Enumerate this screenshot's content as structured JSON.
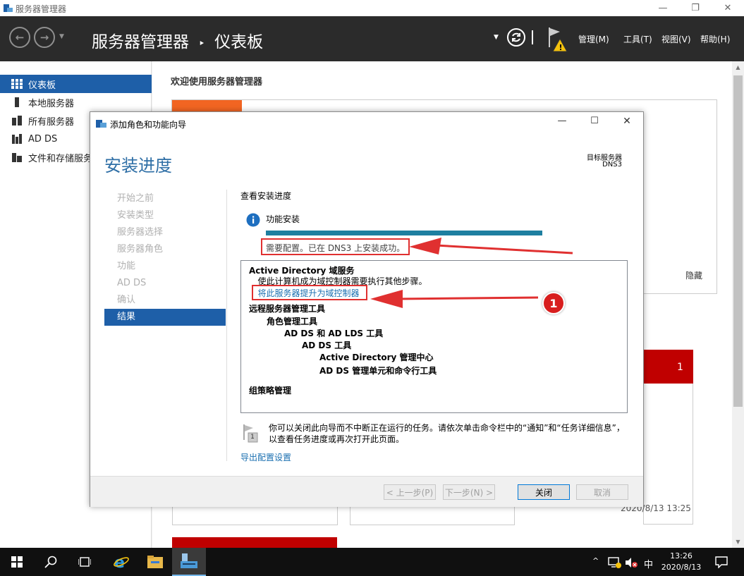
{
  "window": {
    "title": "服务器管理器",
    "minimize": "—",
    "maximize": "❐",
    "close": "✕"
  },
  "header": {
    "breadcrumb_app": "服务器管理器",
    "breadcrumb_sep": "‣",
    "breadcrumb_page": "仪表板",
    "menus": [
      "管理(M)",
      "工具(T)",
      "视图(V)",
      "帮助(H)"
    ]
  },
  "nav": {
    "items": [
      {
        "label": "仪表板",
        "selected": true
      },
      {
        "label": "本地服务器"
      },
      {
        "label": "所有服务器"
      },
      {
        "label": "AD DS"
      },
      {
        "label": "文件和存储服务"
      }
    ]
  },
  "main": {
    "welcome": "欢迎使用服务器管理器",
    "hide": "隐藏",
    "tile_count": "1",
    "timestamp": "2020/8/13 13:25"
  },
  "wizard": {
    "title": "添加角色和功能向导",
    "heading": "安装进度",
    "target_label": "目标服务器",
    "target_server": "DNS3",
    "steps": [
      "开始之前",
      "安装类型",
      "服务器选择",
      "服务器角色",
      "功能",
      "AD DS",
      "确认",
      "结果"
    ],
    "current_step_index": 7,
    "view_progress": "查看安装进度",
    "feature_install": "功能安装",
    "progress_percent": 100,
    "status_message": "需要配置。已在 DNS3 上安装成功。",
    "results": [
      {
        "text": "Active Directory 域服务",
        "bold": true,
        "level": 0
      },
      {
        "text": "使此计算机成为域控制器需要执行其他步骤。",
        "bold": false,
        "level": 0.5
      },
      {
        "text": "将此服务器提升为域控制器",
        "link": true,
        "level": 0.5
      },
      {
        "text": "远程服务器管理工具",
        "bold": true,
        "level": 0
      },
      {
        "text": "角色管理工具",
        "bold": true,
        "level": 1
      },
      {
        "text": "AD DS 和 AD LDS 工具",
        "bold": true,
        "level": 2
      },
      {
        "text": "AD DS 工具",
        "bold": true,
        "level": 3
      },
      {
        "text": "Active Directory 管理中心",
        "bold": true,
        "level": 4
      },
      {
        "text": "AD DS 管理单元和命令行工具",
        "bold": true,
        "level": 4
      },
      {
        "text": "组策略管理",
        "bold": true,
        "level": 0
      }
    ],
    "notice": "你可以关闭此向导而不中断正在运行的任务。请依次单击命令栏中的“通知”和“任务详细信息”，以查看任务进度或再次打开此页面。",
    "notice_badge": "1",
    "export_link": "导出配置设置",
    "buttons": {
      "prev": "< 上一步(P)",
      "next": "下一步(N) >",
      "close": "关闭",
      "cancel": "取消"
    },
    "annotation_badge": "1"
  },
  "taskbar": {
    "time": "13:26",
    "date": "2020/8/13",
    "ime": "中"
  },
  "colors": {
    "accent": "#1e5fa8",
    "progress": "#1e7fa0",
    "alert": "#d00000",
    "annotation": "#e03030",
    "tile_orange": "#f26522"
  }
}
